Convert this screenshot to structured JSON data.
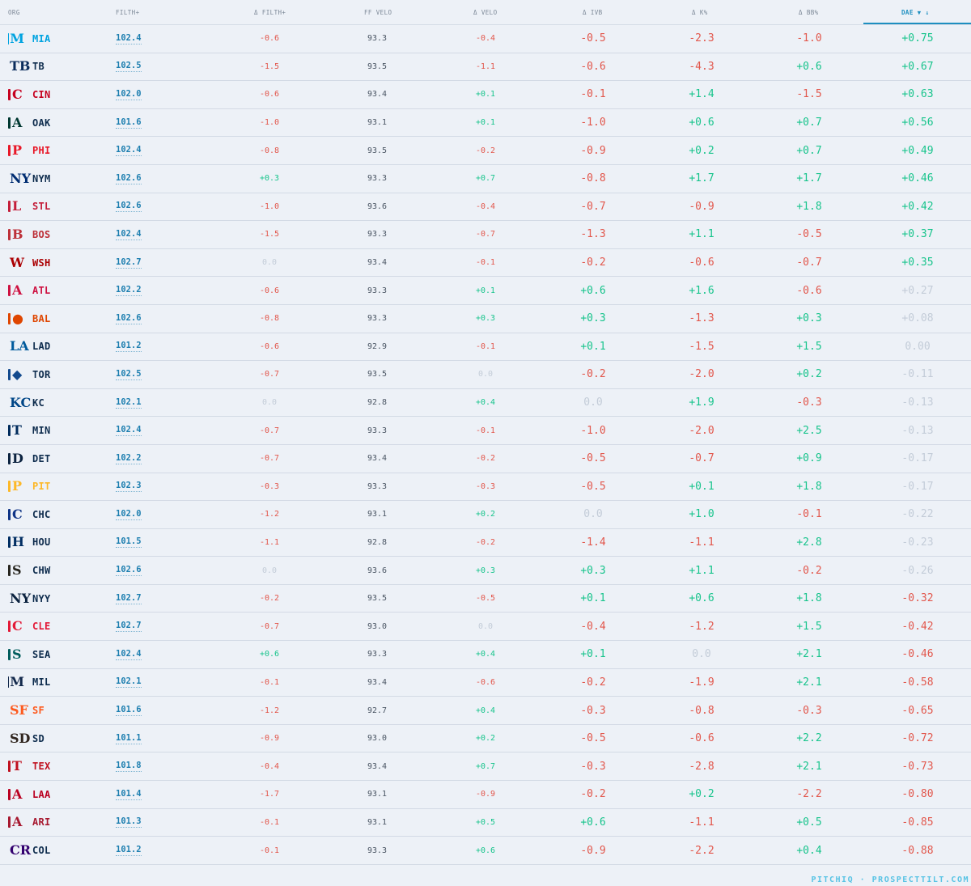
{
  "headers": {
    "org": "ORG",
    "filth": "FILTH+",
    "dfilth": "Δ FILTH+",
    "velo": "FF VELO",
    "dvelo": "Δ VELO",
    "divb": "Δ IVB",
    "dk": "Δ K%",
    "dbb": "Δ BB%",
    "dae": "DAE ▼ ↓"
  },
  "footer": "PITCHIQ · PROSPECTTILT.COM",
  "colors": {
    "accent": "#1e8fc0",
    "negative": "#e2574c",
    "positive": "#18c48c",
    "neutral": "#c3ccd8"
  },
  "rows": [
    {
      "org": "MIA",
      "icon": "marlins-logo-icon",
      "glyph": "M",
      "color": "#00a3e0",
      "filth": "102.4",
      "dfilth": "-0.6",
      "velo": "93.3",
      "dvelo": "-0.4",
      "divb": "-0.5",
      "dk": "-2.3",
      "dbb": "-1.0",
      "dae": "+0.75"
    },
    {
      "org": "TB",
      "icon": "rays-logo-icon",
      "glyph": "TB",
      "color": "#092c5c",
      "filth": "102.5",
      "dfilth": "-1.5",
      "velo": "93.5",
      "dvelo": "-1.1",
      "divb": "-0.6",
      "dk": "-4.3",
      "dbb": "+0.6",
      "dae": "+0.67"
    },
    {
      "org": "CIN",
      "icon": "reds-logo-icon",
      "glyph": "C",
      "color": "#c6011f",
      "filth": "102.0",
      "dfilth": "-0.6",
      "velo": "93.4",
      "dvelo": "+0.1",
      "divb": "-0.1",
      "dk": "+1.4",
      "dbb": "-1.5",
      "dae": "+0.63"
    },
    {
      "org": "OAK",
      "icon": "athletics-logo-icon",
      "glyph": "A",
      "color": "#003831",
      "filth": "101.6",
      "dfilth": "-1.0",
      "velo": "93.1",
      "dvelo": "+0.1",
      "divb": "-1.0",
      "dk": "+0.6",
      "dbb": "+0.7",
      "dae": "+0.56"
    },
    {
      "org": "PHI",
      "icon": "phillies-logo-icon",
      "glyph": "P",
      "color": "#e81828",
      "filth": "102.4",
      "dfilth": "-0.8",
      "velo": "93.5",
      "dvelo": "-0.2",
      "divb": "-0.9",
      "dk": "+0.2",
      "dbb": "+0.7",
      "dae": "+0.49"
    },
    {
      "org": "NYM",
      "icon": "mets-logo-icon",
      "glyph": "NY",
      "color": "#002d72",
      "filth": "102.6",
      "dfilth": "+0.3",
      "velo": "93.3",
      "dvelo": "+0.7",
      "divb": "-0.8",
      "dk": "+1.7",
      "dbb": "+1.7",
      "dae": "+0.46"
    },
    {
      "org": "STL",
      "icon": "cardinals-logo-icon",
      "glyph": "L",
      "color": "#c41e3a",
      "filth": "102.6",
      "dfilth": "-1.0",
      "velo": "93.6",
      "dvelo": "-0.4",
      "divb": "-0.7",
      "dk": "-0.9",
      "dbb": "+1.8",
      "dae": "+0.42"
    },
    {
      "org": "BOS",
      "icon": "red-sox-logo-icon",
      "glyph": "B",
      "color": "#bd3039",
      "filth": "102.4",
      "dfilth": "-1.5",
      "velo": "93.3",
      "dvelo": "-0.7",
      "divb": "-1.3",
      "dk": "+1.1",
      "dbb": "-0.5",
      "dae": "+0.37"
    },
    {
      "org": "WSH",
      "icon": "nationals-logo-icon",
      "glyph": "W",
      "color": "#ab0003",
      "filth": "102.7",
      "dfilth": "0.0",
      "velo": "93.4",
      "dvelo": "-0.1",
      "divb": "-0.2",
      "dk": "-0.6",
      "dbb": "-0.7",
      "dae": "+0.35"
    },
    {
      "org": "ATL",
      "icon": "braves-logo-icon",
      "glyph": "A",
      "color": "#ce1141",
      "filth": "102.2",
      "dfilth": "-0.6",
      "velo": "93.3",
      "dvelo": "+0.1",
      "divb": "+0.6",
      "dk": "+1.6",
      "dbb": "-0.6",
      "dae": "+0.27"
    },
    {
      "org": "BAL",
      "icon": "orioles-logo-icon",
      "glyph": "●",
      "color": "#df4601",
      "filth": "102.6",
      "dfilth": "-0.8",
      "velo": "93.3",
      "dvelo": "+0.3",
      "divb": "+0.3",
      "dk": "-1.3",
      "dbb": "+0.3",
      "dae": "+0.08"
    },
    {
      "org": "LAD",
      "icon": "dodgers-logo-icon",
      "glyph": "LA",
      "color": "#005a9c",
      "filth": "101.2",
      "dfilth": "-0.6",
      "velo": "92.9",
      "dvelo": "-0.1",
      "divb": "+0.1",
      "dk": "-1.5",
      "dbb": "+1.5",
      "dae": "0.00"
    },
    {
      "org": "TOR",
      "icon": "blue-jays-logo-icon",
      "glyph": "◆",
      "color": "#134a8e",
      "filth": "102.5",
      "dfilth": "-0.7",
      "velo": "93.5",
      "dvelo": "0.0",
      "divb": "-0.2",
      "dk": "-2.0",
      "dbb": "+0.2",
      "dae": "-0.11"
    },
    {
      "org": "KC",
      "icon": "royals-logo-icon",
      "glyph": "KC",
      "color": "#004687",
      "filth": "102.1",
      "dfilth": "0.0",
      "velo": "92.8",
      "dvelo": "+0.4",
      "divb": "0.0",
      "dk": "+1.9",
      "dbb": "-0.3",
      "dae": "-0.13"
    },
    {
      "org": "MIN",
      "icon": "twins-logo-icon",
      "glyph": "T",
      "color": "#002b5c",
      "filth": "102.4",
      "dfilth": "-0.7",
      "velo": "93.3",
      "dvelo": "-0.1",
      "divb": "-1.0",
      "dk": "-2.0",
      "dbb": "+2.5",
      "dae": "-0.13"
    },
    {
      "org": "DET",
      "icon": "tigers-logo-icon",
      "glyph": "D",
      "color": "#0c2340",
      "filth": "102.2",
      "dfilth": "-0.7",
      "velo": "93.4",
      "dvelo": "-0.2",
      "divb": "-0.5",
      "dk": "-0.7",
      "dbb": "+0.9",
      "dae": "-0.17"
    },
    {
      "org": "PIT",
      "icon": "pirates-logo-icon",
      "glyph": "P",
      "color": "#fdb827",
      "filth": "102.3",
      "dfilth": "-0.3",
      "velo": "93.3",
      "dvelo": "-0.3",
      "divb": "-0.5",
      "dk": "+0.1",
      "dbb": "+1.8",
      "dae": "-0.17"
    },
    {
      "org": "CHC",
      "icon": "cubs-logo-icon",
      "glyph": "C",
      "color": "#0e3386",
      "filth": "102.0",
      "dfilth": "-1.2",
      "velo": "93.1",
      "dvelo": "+0.2",
      "divb": "0.0",
      "dk": "+1.0",
      "dbb": "-0.1",
      "dae": "-0.22"
    },
    {
      "org": "HOU",
      "icon": "astros-logo-icon",
      "glyph": "H",
      "color": "#002d62",
      "filth": "101.5",
      "dfilth": "-1.1",
      "velo": "92.8",
      "dvelo": "-0.2",
      "divb": "-1.4",
      "dk": "-1.1",
      "dbb": "+2.8",
      "dae": "-0.23"
    },
    {
      "org": "CHW",
      "icon": "white-sox-logo-icon",
      "glyph": "S",
      "color": "#27251f",
      "filth": "102.6",
      "dfilth": "0.0",
      "velo": "93.6",
      "dvelo": "+0.3",
      "divb": "+0.3",
      "dk": "+1.1",
      "dbb": "-0.2",
      "dae": "-0.26"
    },
    {
      "org": "NYY",
      "icon": "yankees-logo-icon",
      "glyph": "NY",
      "color": "#0c2340",
      "filth": "102.7",
      "dfilth": "-0.2",
      "velo": "93.5",
      "dvelo": "-0.5",
      "divb": "+0.1",
      "dk": "+0.6",
      "dbb": "+1.8",
      "dae": "-0.32"
    },
    {
      "org": "CLE",
      "icon": "guardians-logo-icon",
      "glyph": "C",
      "color": "#e31937",
      "filth": "102.7",
      "dfilth": "-0.7",
      "velo": "93.0",
      "dvelo": "0.0",
      "divb": "-0.4",
      "dk": "-1.2",
      "dbb": "+1.5",
      "dae": "-0.42"
    },
    {
      "org": "SEA",
      "icon": "mariners-logo-icon",
      "glyph": "S",
      "color": "#005c5c",
      "filth": "102.4",
      "dfilth": "+0.6",
      "velo": "93.3",
      "dvelo": "+0.4",
      "divb": "+0.1",
      "dk": "0.0",
      "dbb": "+2.1",
      "dae": "-0.46"
    },
    {
      "org": "MIL",
      "icon": "brewers-logo-icon",
      "glyph": "M",
      "color": "#12284b",
      "filth": "102.1",
      "dfilth": "-0.1",
      "velo": "93.4",
      "dvelo": "-0.6",
      "divb": "-0.2",
      "dk": "-1.9",
      "dbb": "+2.1",
      "dae": "-0.58"
    },
    {
      "org": "SF",
      "icon": "giants-logo-icon",
      "glyph": "SF",
      "color": "#fd5a1e",
      "filth": "101.6",
      "dfilth": "-1.2",
      "velo": "92.7",
      "dvelo": "+0.4",
      "divb": "-0.3",
      "dk": "-0.8",
      "dbb": "-0.3",
      "dae": "-0.65"
    },
    {
      "org": "SD",
      "icon": "padres-logo-icon",
      "glyph": "SD",
      "color": "#2f241d",
      "filth": "101.1",
      "dfilth": "-0.9",
      "velo": "93.0",
      "dvelo": "+0.2",
      "divb": "-0.5",
      "dk": "-0.6",
      "dbb": "+2.2",
      "dae": "-0.72"
    },
    {
      "org": "TEX",
      "icon": "rangers-logo-icon",
      "glyph": "T",
      "color": "#c0111f",
      "filth": "101.8",
      "dfilth": "-0.4",
      "velo": "93.4",
      "dvelo": "+0.7",
      "divb": "-0.3",
      "dk": "-2.8",
      "dbb": "+2.1",
      "dae": "-0.73"
    },
    {
      "org": "LAA",
      "icon": "angels-logo-icon",
      "glyph": "A",
      "color": "#ba0021",
      "filth": "101.4",
      "dfilth": "-1.7",
      "velo": "93.1",
      "dvelo": "-0.9",
      "divb": "-0.2",
      "dk": "+0.2",
      "dbb": "-2.2",
      "dae": "-0.80"
    },
    {
      "org": "ARI",
      "icon": "diamondbacks-logo-icon",
      "glyph": "A",
      "color": "#a71930",
      "filth": "101.3",
      "dfilth": "-0.1",
      "velo": "93.1",
      "dvelo": "+0.5",
      "divb": "+0.6",
      "dk": "-1.1",
      "dbb": "+0.5",
      "dae": "-0.85"
    },
    {
      "org": "COL",
      "icon": "rockies-logo-icon",
      "glyph": "CR",
      "color": "#33006f",
      "filth": "101.2",
      "dfilth": "-0.1",
      "velo": "93.3",
      "dvelo": "+0.6",
      "divb": "-0.9",
      "dk": "-2.2",
      "dbb": "+0.4",
      "dae": "-0.88"
    }
  ]
}
